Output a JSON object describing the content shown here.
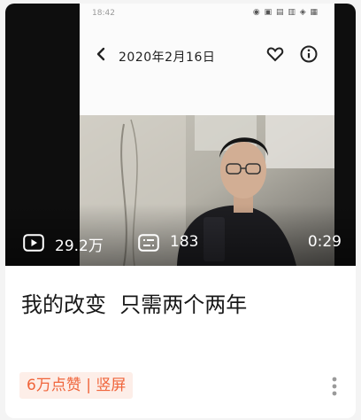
{
  "video": {
    "thumbnail": {
      "status_time": "18:42",
      "status_icons": "◉ ▣ ▤ ▥ ◈ ▦",
      "date_title": "2020年2月16日"
    },
    "play_count": "29.2万",
    "danmaku_count": "183",
    "duration": "0:29",
    "title": "我的改变  只需两个两年",
    "tag": "6万点赞 | 竖屏"
  },
  "colors": {
    "tag_text": "#f0643a",
    "tag_bg": "#fdeee8",
    "title": "#181818"
  }
}
